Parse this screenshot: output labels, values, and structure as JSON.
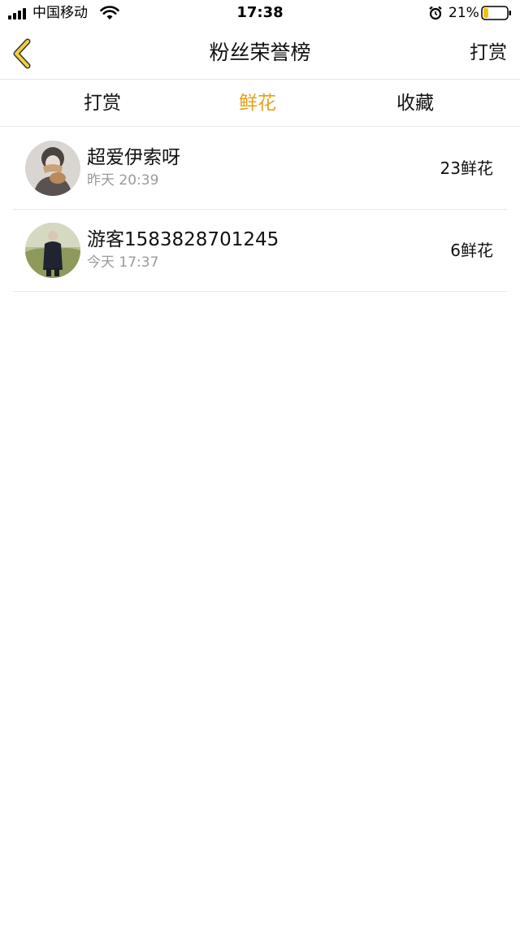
{
  "status_bar": {
    "carrier": "中国移动",
    "time": "17:38",
    "battery_percent": "21%",
    "battery_level": 0.21,
    "icons": [
      "signal-icon",
      "wifi-icon",
      "alarm-icon",
      "battery-icon"
    ]
  },
  "nav": {
    "title": "粉丝荣誉榜",
    "right_action": "打赏",
    "back_icon": "chevron-left-icon"
  },
  "tabs": [
    {
      "label": "打赏",
      "active": false
    },
    {
      "label": "鲜花",
      "active": true
    },
    {
      "label": "收藏",
      "active": false
    }
  ],
  "fans": [
    {
      "name": "超爱伊索呀",
      "time": "昨天 20:39",
      "count": "23鲜花",
      "avatar": "avatar-icon"
    },
    {
      "name": "游客1583828701245",
      "time": "今天 17:37",
      "count": "6鲜花",
      "avatar": "avatar-icon"
    }
  ],
  "colors": {
    "accent": "#e8a019",
    "back_arrow": "#f0d13c",
    "muted_text": "#9a9a9a",
    "divider": "#e8e8e8"
  }
}
